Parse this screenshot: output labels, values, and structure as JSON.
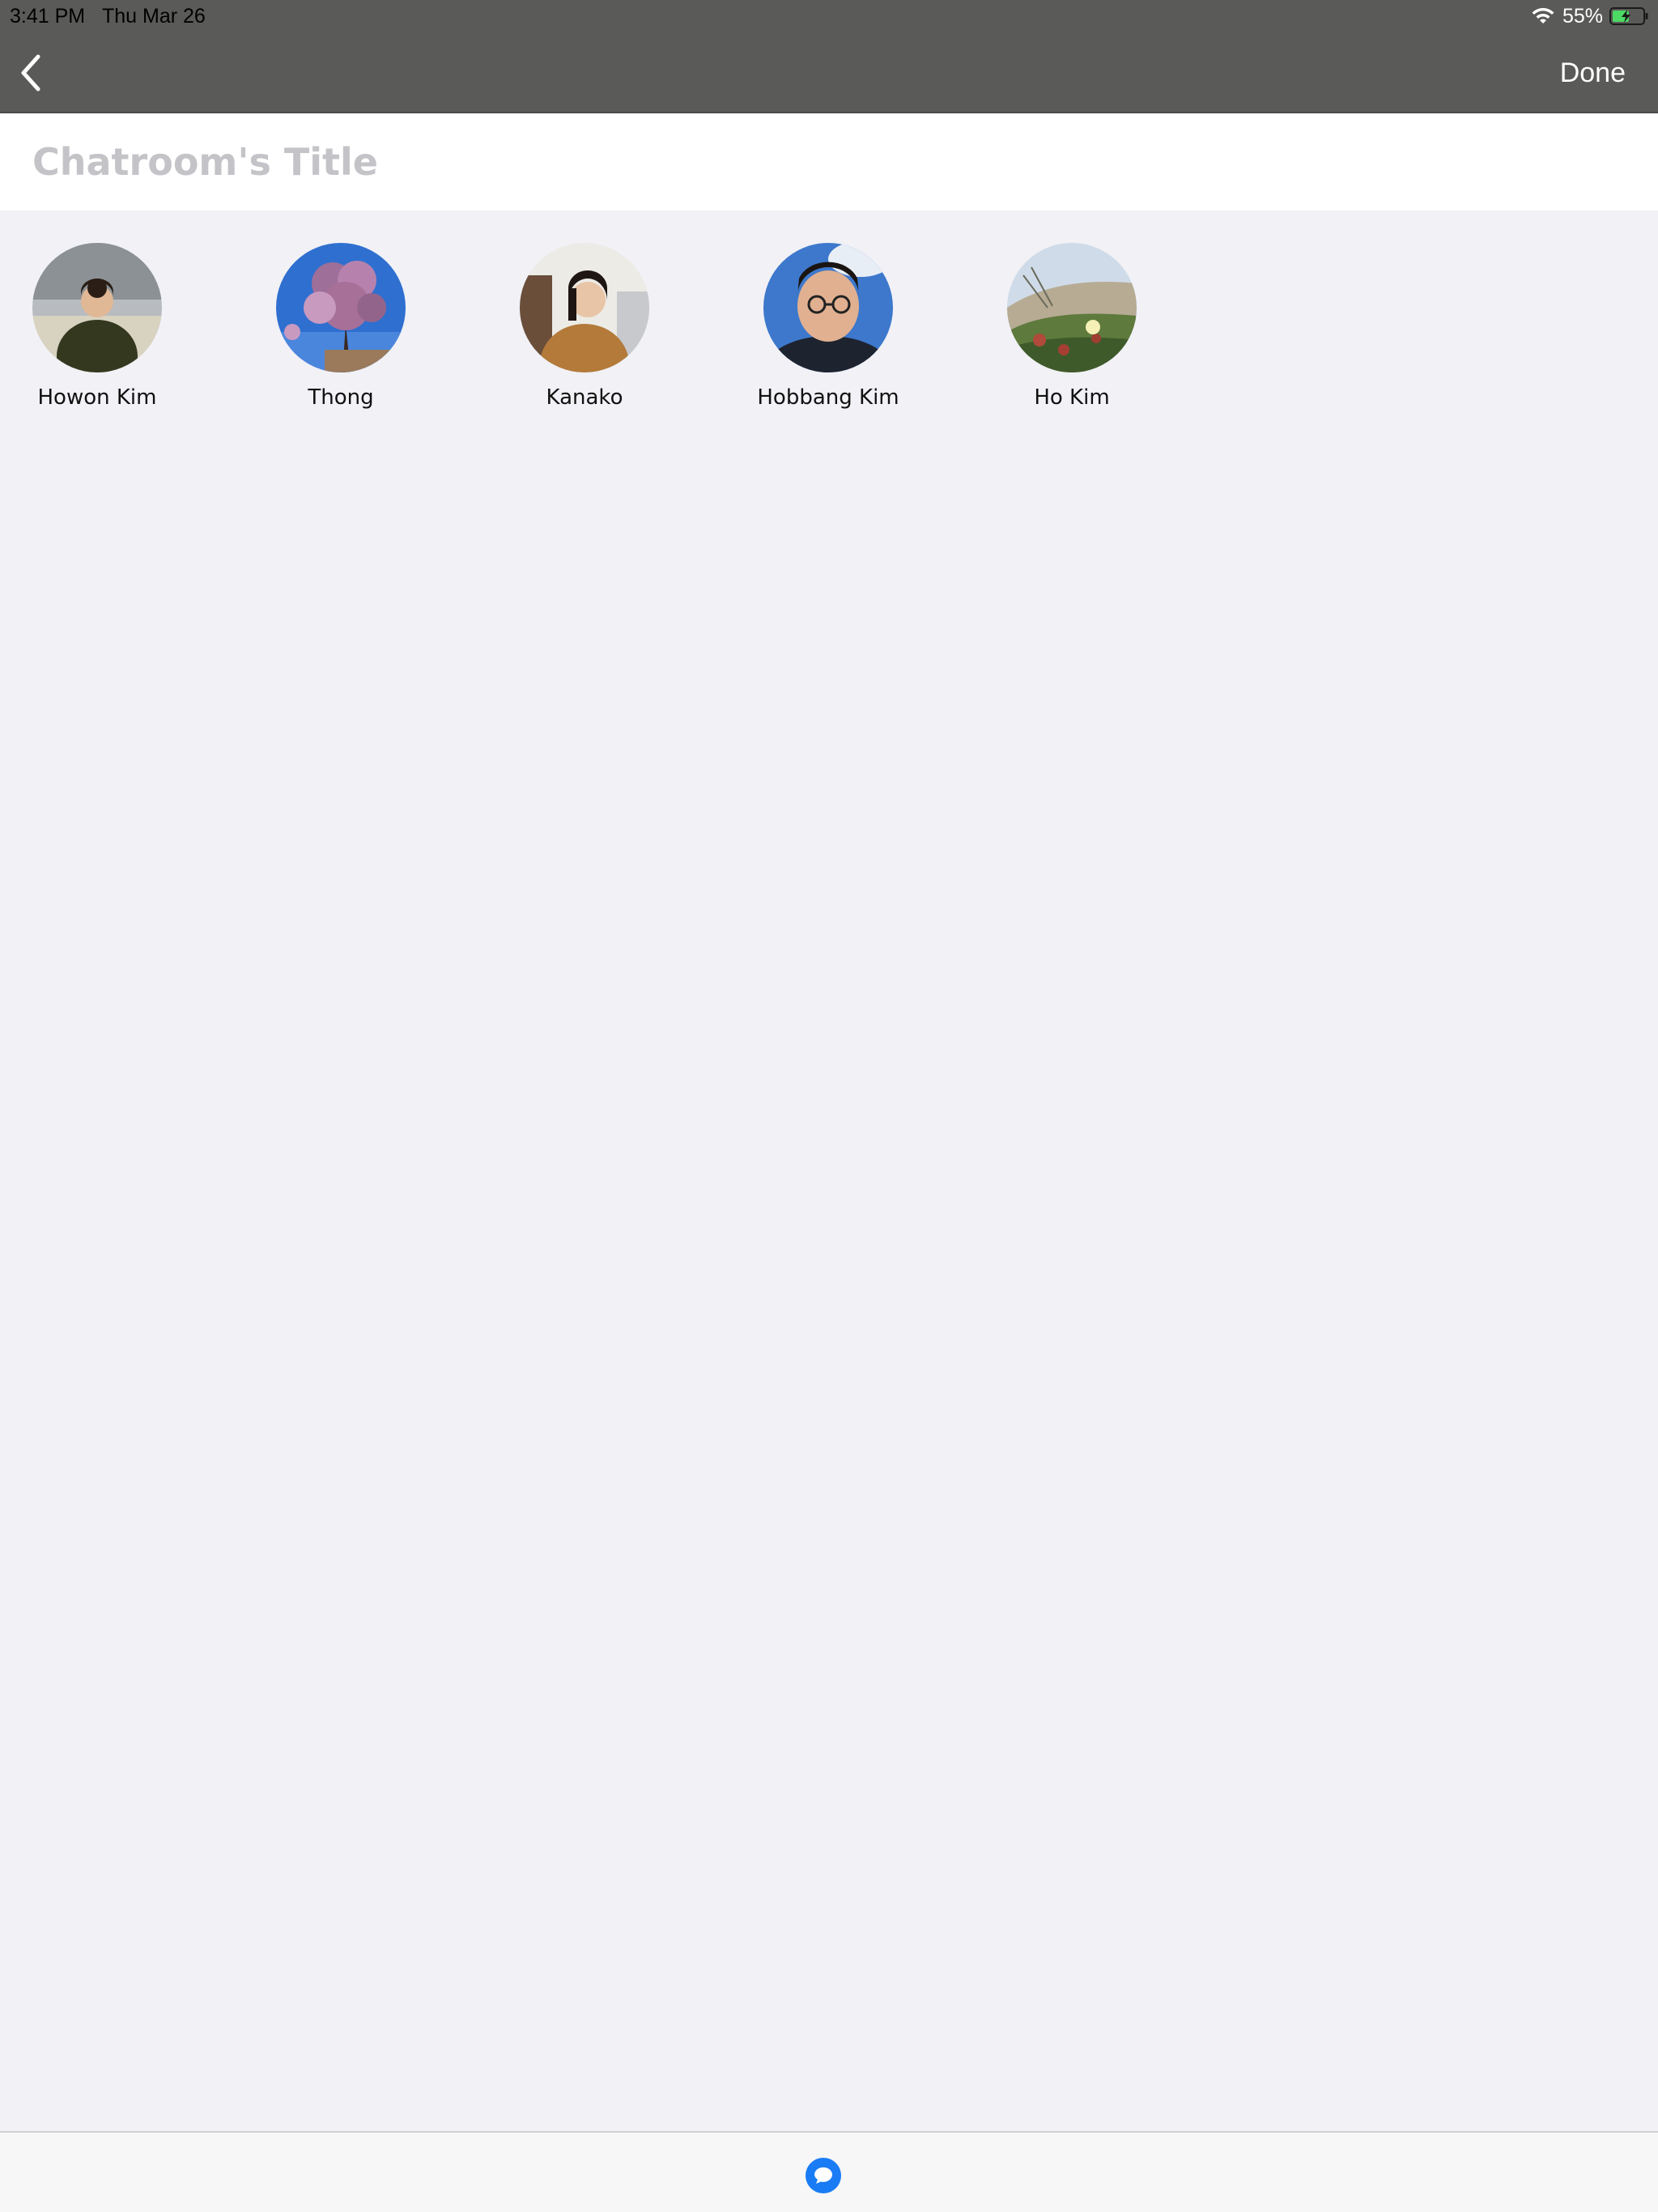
{
  "status_bar": {
    "time": "3:41 PM",
    "date": "Thu Mar 26",
    "battery_percent": "55%",
    "battery_level": 0.55,
    "battery_color": "#4cd964",
    "charging": true
  },
  "nav": {
    "back_icon": "chevron-left-icon",
    "done_label": "Done",
    "background": "#5a5a58"
  },
  "title_field": {
    "value": "",
    "placeholder": "Chatroom's Title"
  },
  "members": [
    {
      "name": "Howon Kim",
      "avatar": "photo-person-beach"
    },
    {
      "name": "Thong",
      "avatar": "photo-cherry-blossom"
    },
    {
      "name": "Kanako",
      "avatar": "photo-person-office"
    },
    {
      "name": "Hobbang Kim",
      "avatar": "photo-person-selfie"
    },
    {
      "name": "Ho Kim",
      "avatar": "photo-flowers-dune"
    }
  ],
  "bottom_bar": {
    "icon": "chat-bubble-icon",
    "accent": "#1a7cf5"
  }
}
